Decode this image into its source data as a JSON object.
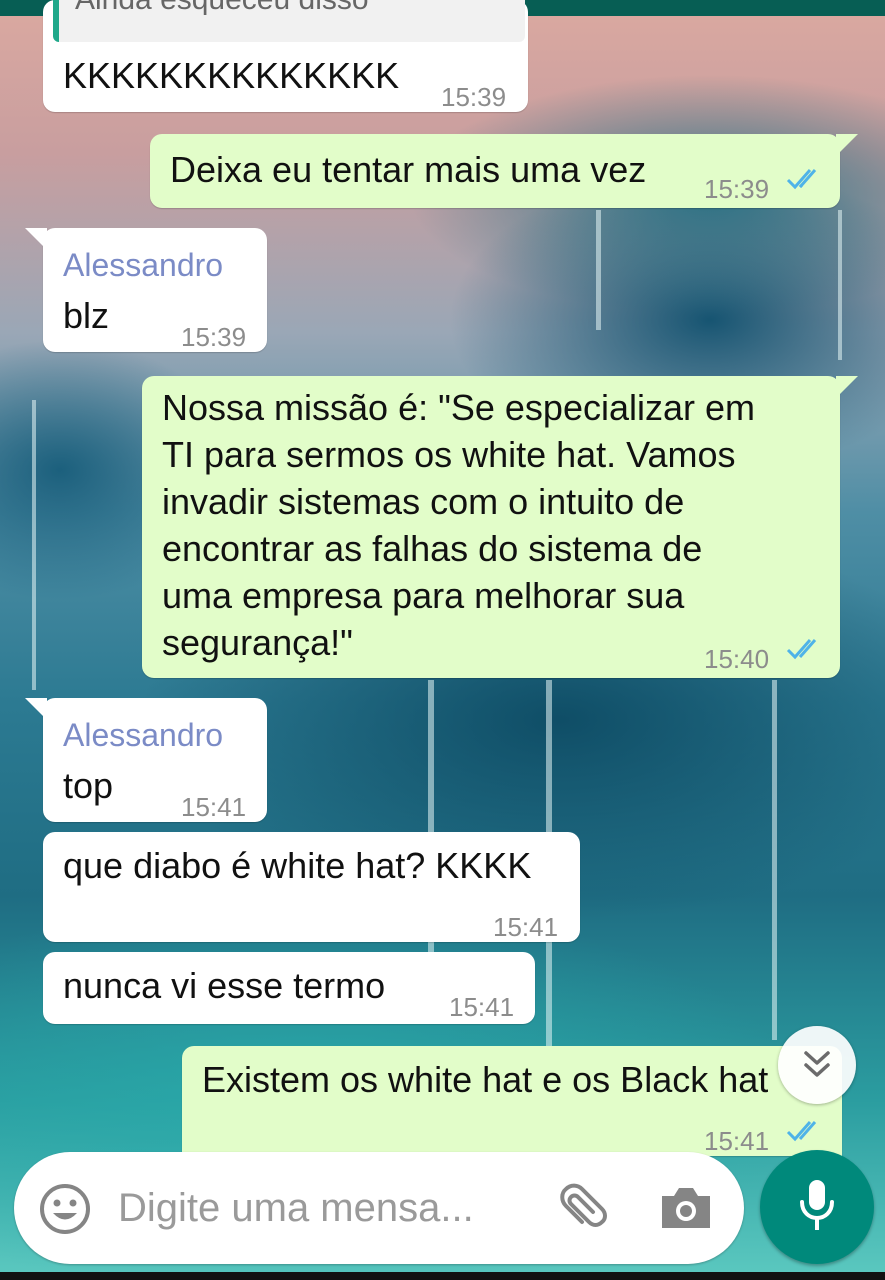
{
  "chat": {
    "quoted_text": "Ainda esqueceu disso",
    "messages": [
      {
        "direction": "in",
        "sender": "",
        "text": "KKKKKKKKKKKKKK",
        "time": "15:39"
      },
      {
        "direction": "out",
        "text": "Deixa eu tentar mais uma vez",
        "time": "15:39",
        "status": "read"
      },
      {
        "direction": "in",
        "sender": "Alessandro",
        "text": "blz",
        "time": "15:39"
      },
      {
        "direction": "out",
        "text_lines": [
          "Nossa missão é: \"Se especializar em",
          "TI para sermos os white hat. Vamos",
          "invadir sistemas com o intuito de",
          "encontrar as falhas do sistema de",
          "uma empresa para melhorar sua",
          "segurança!\""
        ],
        "time": "15:40",
        "status": "read"
      },
      {
        "direction": "in",
        "sender": "Alessandro",
        "text": "top",
        "time": "15:41"
      },
      {
        "direction": "in",
        "sender": "",
        "text": "que diabo é white hat? KKKK",
        "time": "15:41"
      },
      {
        "direction": "in",
        "sender": "",
        "text": "nunca vi esse termo",
        "time": "15:41"
      },
      {
        "direction": "out",
        "text": "Existem os white hat e os Black hat",
        "time": "15:41",
        "status": "read"
      }
    ]
  },
  "composer": {
    "placeholder": "Digite uma mensa...",
    "emoji_icon": "emoji-icon",
    "attach_icon": "paperclip-icon",
    "camera_icon": "camera-icon",
    "mic_icon": "microphone-icon"
  },
  "scroll_down_icon": "double-chevron-down-icon",
  "colors": {
    "incoming_bubble": "#ffffff",
    "outgoing_bubble": "#e2fdc9",
    "sender_name": "#7b8bc6",
    "read_ticks": "#4fb3e8",
    "mic_button": "#00897b",
    "header": "#075e54"
  }
}
